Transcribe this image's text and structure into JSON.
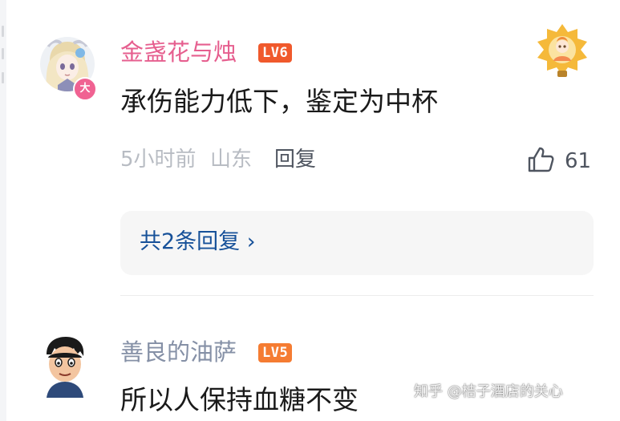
{
  "comments": [
    {
      "username": "金盏花与烛",
      "level": "LV6",
      "avatar_badge": "大",
      "text": "承伤能力低下，鉴定为中杯",
      "time": "5小时前",
      "location": "山东",
      "reply_label": "回复",
      "likes": "61",
      "replies_summary": "共2条回复 ›",
      "colors": {
        "username": "#e65f8f",
        "level": "#f0592c"
      }
    },
    {
      "username": "善良的油萨",
      "level": "LV5",
      "text": "所以人保持血糖不变",
      "colors": {
        "username": "#8590a6",
        "level": "#f57c32"
      }
    }
  ],
  "watermark": "知乎 @桔子酒店的关心",
  "icons": {
    "like": "thumbs-up-icon",
    "medal": "medal-icon",
    "chevron": "chevron-right-icon"
  }
}
